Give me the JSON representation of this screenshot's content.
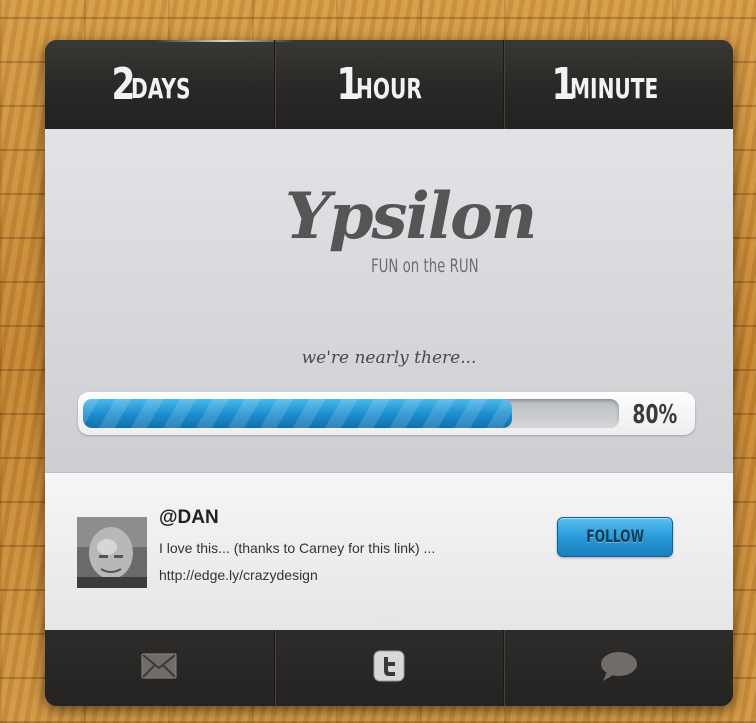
{
  "countdown": [
    {
      "value": "2",
      "unit": "DAYS"
    },
    {
      "value": "1",
      "unit": "HOUR"
    },
    {
      "value": "1",
      "unit": "MINUTE"
    }
  ],
  "brand": {
    "logo_text": "Ypsilon",
    "tagline": "FUN on the RUN"
  },
  "status_message": "we're nearly there...",
  "progress": {
    "value_fraction": 0.8,
    "label": "80%",
    "fill_color": "#1e8fd0"
  },
  "tweet": {
    "handle": "@DAN",
    "text": "I love this... (thanks to Carney for this link) ...",
    "link": "http://edge.ly/crazydesign",
    "follow_label": "FOLLOW"
  },
  "bottom_nav": [
    {
      "icon": "envelope-icon",
      "active": false
    },
    {
      "icon": "twitter-icon",
      "active": true
    },
    {
      "icon": "speech-bubble-icon",
      "active": false
    }
  ]
}
